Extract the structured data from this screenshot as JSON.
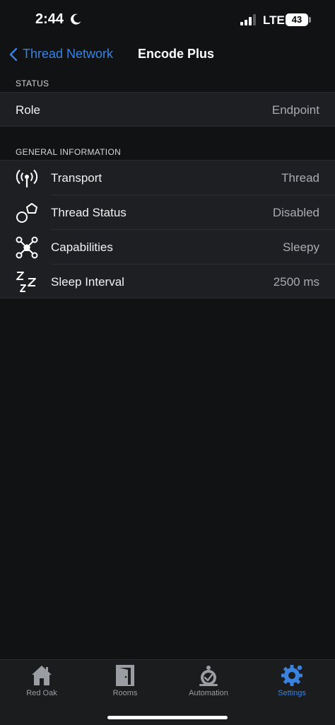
{
  "status_bar": {
    "time": "2:44",
    "network": "LTE",
    "battery": "43"
  },
  "nav": {
    "back_label": "Thread Network",
    "title": "Encode Plus"
  },
  "sections": {
    "status": {
      "header": "STATUS",
      "rows": [
        {
          "label": "Role",
          "value": "Endpoint"
        }
      ]
    },
    "general": {
      "header": "GENERAL INFORMATION",
      "rows": [
        {
          "icon": "antenna-icon",
          "label": "Transport",
          "value": "Thread"
        },
        {
          "icon": "shapes-icon",
          "label": "Thread Status",
          "value": "Disabled"
        },
        {
          "icon": "network-nodes-icon",
          "label": "Capabilities",
          "value": "Sleepy"
        },
        {
          "icon": "sleep-zzz-icon",
          "label": "Sleep Interval",
          "value": "2500 ms"
        }
      ]
    }
  },
  "tabs": [
    {
      "icon": "house-icon",
      "label": "Red Oak",
      "active": false
    },
    {
      "icon": "door-icon",
      "label": "Rooms",
      "active": false
    },
    {
      "icon": "automation-icon",
      "label": "Automation",
      "active": false
    },
    {
      "icon": "gear-icon",
      "label": "Settings",
      "active": true
    }
  ],
  "colors": {
    "accent": "#3a82e0",
    "background": "#111213",
    "cell": "#1d1f22"
  }
}
